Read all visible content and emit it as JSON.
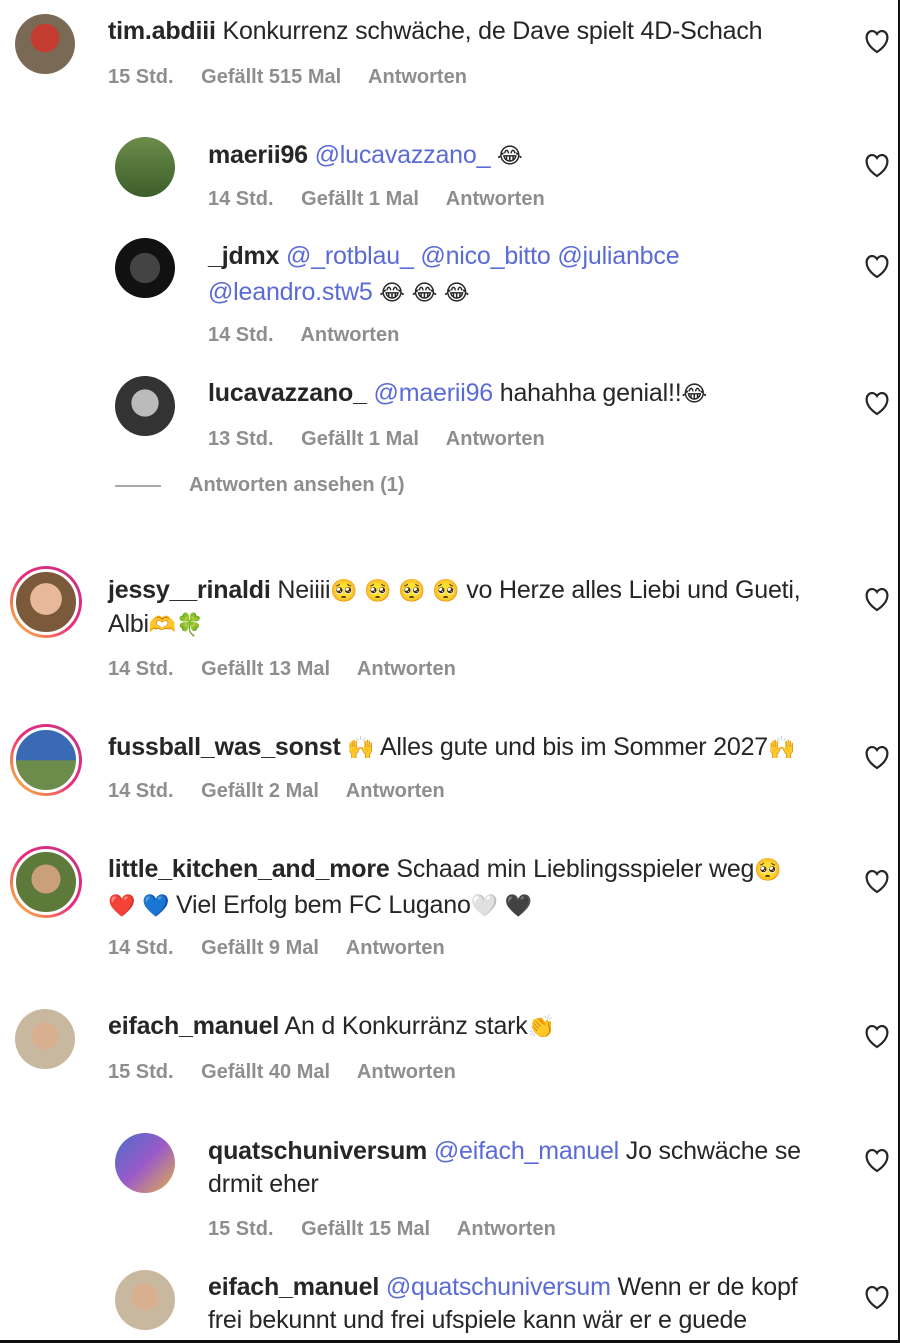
{
  "comments": [
    {
      "user": "tim.abdiii",
      "text": "Konkurrenz schwäche, de Dave spielt 4D-Schach",
      "time": "15 Std.",
      "likes": "Gefällt 515 Mal",
      "reply": "Antworten"
    },
    {
      "user": "maerii96",
      "mention": "@lucavazzano_",
      "emoji": "😂",
      "time": "14 Std.",
      "likes": "Gefällt 1 Mal",
      "reply": "Antworten"
    },
    {
      "user": "_jdmx",
      "mention": "@_rotblau_ @nico_bitto @julianbce",
      "mention2": "@leandro.stw5",
      "emoji": "😂 😂 😂",
      "time": "14 Std.",
      "reply": "Antworten"
    },
    {
      "user": "lucavazzano_",
      "mention": "@maerii96",
      "text": "hahahha genial!!",
      "emoji": "😂",
      "time": "13 Std.",
      "likes": "Gefällt 1 Mal",
      "reply": "Antworten"
    },
    {
      "user": "jessy__rinaldi",
      "text": "Neiiii",
      "emoji": "🥺 🥺 🥺 🥺",
      "text2": "vo Herze alles Liebi und Gueti,",
      "text3": "Albi",
      "emoji2": "🫶🍀",
      "time": "14 Std.",
      "likes": "Gefällt 13 Mal",
      "reply": "Antworten"
    },
    {
      "user": "fussball_was_sonst",
      "emoji": "🙌",
      "text": "Alles gute und bis im Sommer 2027",
      "emoji2": "🙌",
      "time": "14 Std.",
      "likes": "Gefällt 2 Mal",
      "reply": "Antworten"
    },
    {
      "user": "little_kitchen_and_more",
      "text": "Schaad min Lieblingsspieler weg",
      "emoji": "🥺",
      "emoji2": "❤️ 💙",
      "text2": "Viel Erfolg bem FC Lugano",
      "emoji3": "🤍 🖤",
      "time": "14 Std.",
      "likes": "Gefällt 9 Mal",
      "reply": "Antworten"
    },
    {
      "user": "eifach_manuel",
      "text": "An d Konkurränz stark",
      "emoji": "👏",
      "time": "15 Std.",
      "likes": "Gefällt 40 Mal",
      "reply": "Antworten"
    },
    {
      "user": "quatschuniversum",
      "mention": "@eifach_manuel",
      "text": "Jo schwäche se",
      "text2": "drmit eher",
      "time": "15 Std.",
      "likes": "Gefällt 15 Mal",
      "reply": "Antworten"
    },
    {
      "user": "eifach_manuel",
      "mention": "@quatschuniversum",
      "text": "Wenn er de kopf",
      "text2": "frei bekunnt und frei ufspiele kann wär er e guede"
    }
  ],
  "view_replies": "Antworten ansehen (1)",
  "icons": {
    "like": "heart-outline-icon"
  }
}
